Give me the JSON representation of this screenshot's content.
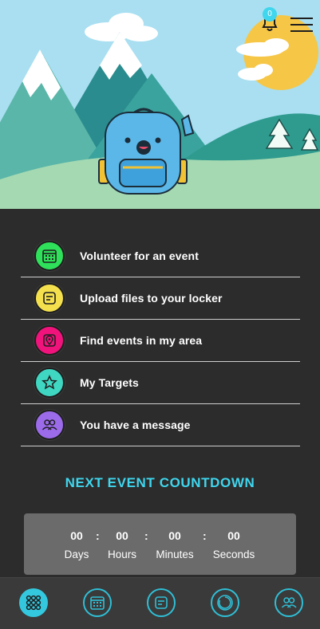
{
  "header": {
    "notification_count": "0",
    "bell_icon": "bell-icon",
    "menu_icon": "hamburger-menu-icon"
  },
  "actions": [
    {
      "label": "Volunteer for an event",
      "icon": "calendar-icon",
      "color": "#2ee05a"
    },
    {
      "label": "Upload files to your locker",
      "icon": "file-icon",
      "color": "#f4e04d"
    },
    {
      "label": "Find events in my area",
      "icon": "location-pin-icon",
      "color": "#f0137b"
    },
    {
      "label": "My Targets",
      "icon": "star-icon",
      "color": "#3fd6c2"
    },
    {
      "label": "You have a message",
      "icon": "users-icon",
      "color": "#9b6bea"
    }
  ],
  "countdown": {
    "title": "NEXT EVENT COUNTDOWN",
    "days": {
      "value": "00",
      "label": "Days"
    },
    "hours": {
      "value": "00",
      "label": "Hours"
    },
    "minutes": {
      "value": "00",
      "label": "Minutes"
    },
    "seconds": {
      "value": "00",
      "label": "Seconds"
    },
    "separator": ":"
  },
  "bottom_nav": [
    {
      "icon": "grid-dots-icon",
      "active": true
    },
    {
      "icon": "calendar-icon",
      "active": false
    },
    {
      "icon": "file-icon",
      "active": false
    },
    {
      "icon": "target-icon",
      "active": false
    },
    {
      "icon": "users-icon",
      "active": false
    }
  ],
  "colors": {
    "accent": "#3fd6ee",
    "background": "#2c2c2c",
    "countdown_box": "#6b6b6b"
  }
}
